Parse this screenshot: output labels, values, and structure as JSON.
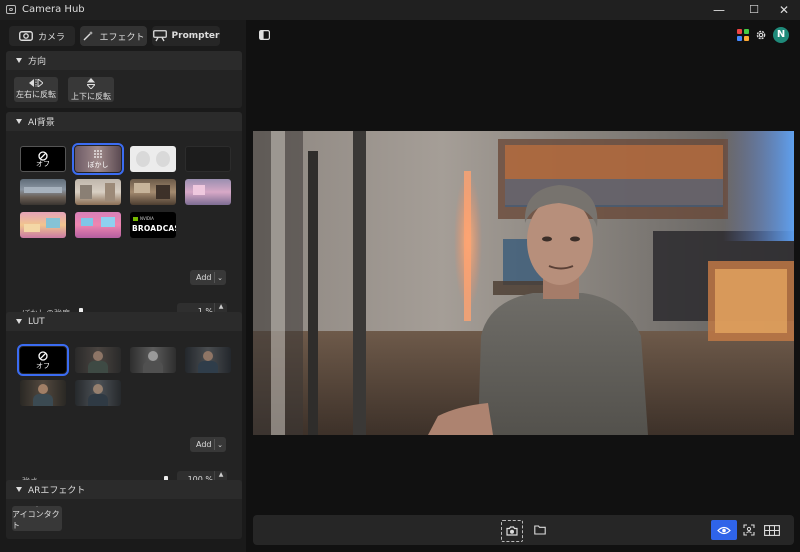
{
  "app": {
    "title": "Camera Hub"
  },
  "window": {
    "minimize": "—",
    "maximize": "☐",
    "close": "✕"
  },
  "tabs": [
    {
      "label": "カメラ",
      "icon": "camera-icon"
    },
    {
      "label": "エフェクト",
      "icon": "magic-wand-icon",
      "active": true
    },
    {
      "label": "Prompter",
      "icon": "prompter-icon"
    }
  ],
  "direction": {
    "title": "方向",
    "flip_horizontal": "左右に反転",
    "flip_vertical": "上下に反転"
  },
  "ai_background": {
    "title": "AI背景",
    "thumbnails": [
      {
        "label": "オフ",
        "kind": "off"
      },
      {
        "label": "ぼかし",
        "kind": "blur",
        "selected": true
      },
      {
        "label": "",
        "kind": "light"
      },
      {
        "label": "",
        "kind": "dark"
      },
      {
        "label": "",
        "kind": "room1"
      },
      {
        "label": "",
        "kind": "room2"
      },
      {
        "label": "",
        "kind": "room3"
      },
      {
        "label": "",
        "kind": "pink-room"
      },
      {
        "label": "",
        "kind": "cartoon1"
      },
      {
        "label": "",
        "kind": "cartoon2"
      },
      {
        "label": "BROADCAST",
        "kind": "broadcast",
        "brand": "NVIDIA"
      }
    ],
    "add_label": "Add",
    "blur_strength_label": "ぼかしの強度",
    "blur_strength_value": "1 %",
    "blur_strength": 0.01
  },
  "lut": {
    "title": "LUT",
    "thumbnails": [
      {
        "label": "オフ",
        "kind": "off",
        "selected": true
      },
      {
        "label": "",
        "kind": "lut1"
      },
      {
        "label": "",
        "kind": "lut2"
      },
      {
        "label": "",
        "kind": "lut3"
      },
      {
        "label": "",
        "kind": "lut4"
      },
      {
        "label": "",
        "kind": "lut5"
      }
    ],
    "add_label": "Add",
    "strength_label": "強さ",
    "strength_value": "100 %",
    "strength": 1.0
  },
  "ar_effect": {
    "title": "ARエフェクト",
    "eye_contact": "アイコンタクト"
  },
  "header_right": {
    "avatar_letter": "N"
  },
  "colors": {
    "accent": "#3b6cf2",
    "avatar_bg": "#1f8a7a"
  }
}
